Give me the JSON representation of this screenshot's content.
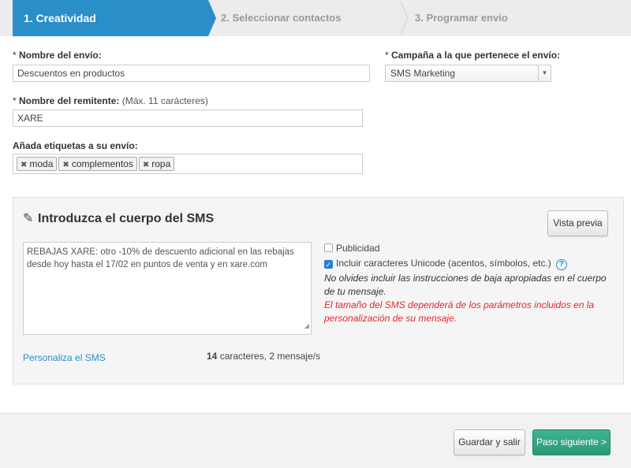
{
  "wizard": {
    "steps": [
      {
        "label": "1. Creatividad"
      },
      {
        "label": "2. Seleccionar contactos"
      },
      {
        "label": "3. Programar envío"
      }
    ]
  },
  "form": {
    "shipment_name": {
      "required": "*",
      "label": "Nombre del envío:",
      "value": "Descuentos en productos"
    },
    "campaign": {
      "required": "*",
      "label": "Campaña a la que pertenece el envío:",
      "selected": "SMS Marketing"
    },
    "sender_name": {
      "required": "*",
      "label": "Nombre del remitente:",
      "hint": "(Máx. 11 carácteres)",
      "value": "XARE"
    },
    "tags": {
      "label": "Añada etiquetas a su envío:",
      "items": [
        "moda",
        "complementos",
        "ropa"
      ]
    }
  },
  "sms_panel": {
    "title": "Introduzca el cuerpo del SMS",
    "preview_button": "Vista previa",
    "body": "REBAJAS XARE: otro -10% de descuento adicional en las rebajas desde hoy hasta el 17/02 en puntos de venta y en xare.com",
    "advertising_label": "Publicidad",
    "advertising_checked": false,
    "unicode_label": "Incluir caracteres Unicode (acentos, símbolos, etc.)",
    "unicode_checked": true,
    "help_icon": "?",
    "note_black": "No olvides incluir las instrucciones de baja apropiadas en el cuerpo de tu mensaje.",
    "note_red": "El tamaño del SMS dependerá de los parámetros incluidos en la personalización de su mensaje.",
    "personalize_link": "Personaliza el SMS",
    "char_count": "14",
    "char_count_suffix": " caracteres, 2 mensaje/s"
  },
  "footer": {
    "save_exit": "Guardar y salir",
    "next_step": "Paso siguiente >"
  },
  "colors": {
    "accent": "#2a8ec9",
    "primary": "#2b9a78",
    "error": "#e0282c"
  }
}
